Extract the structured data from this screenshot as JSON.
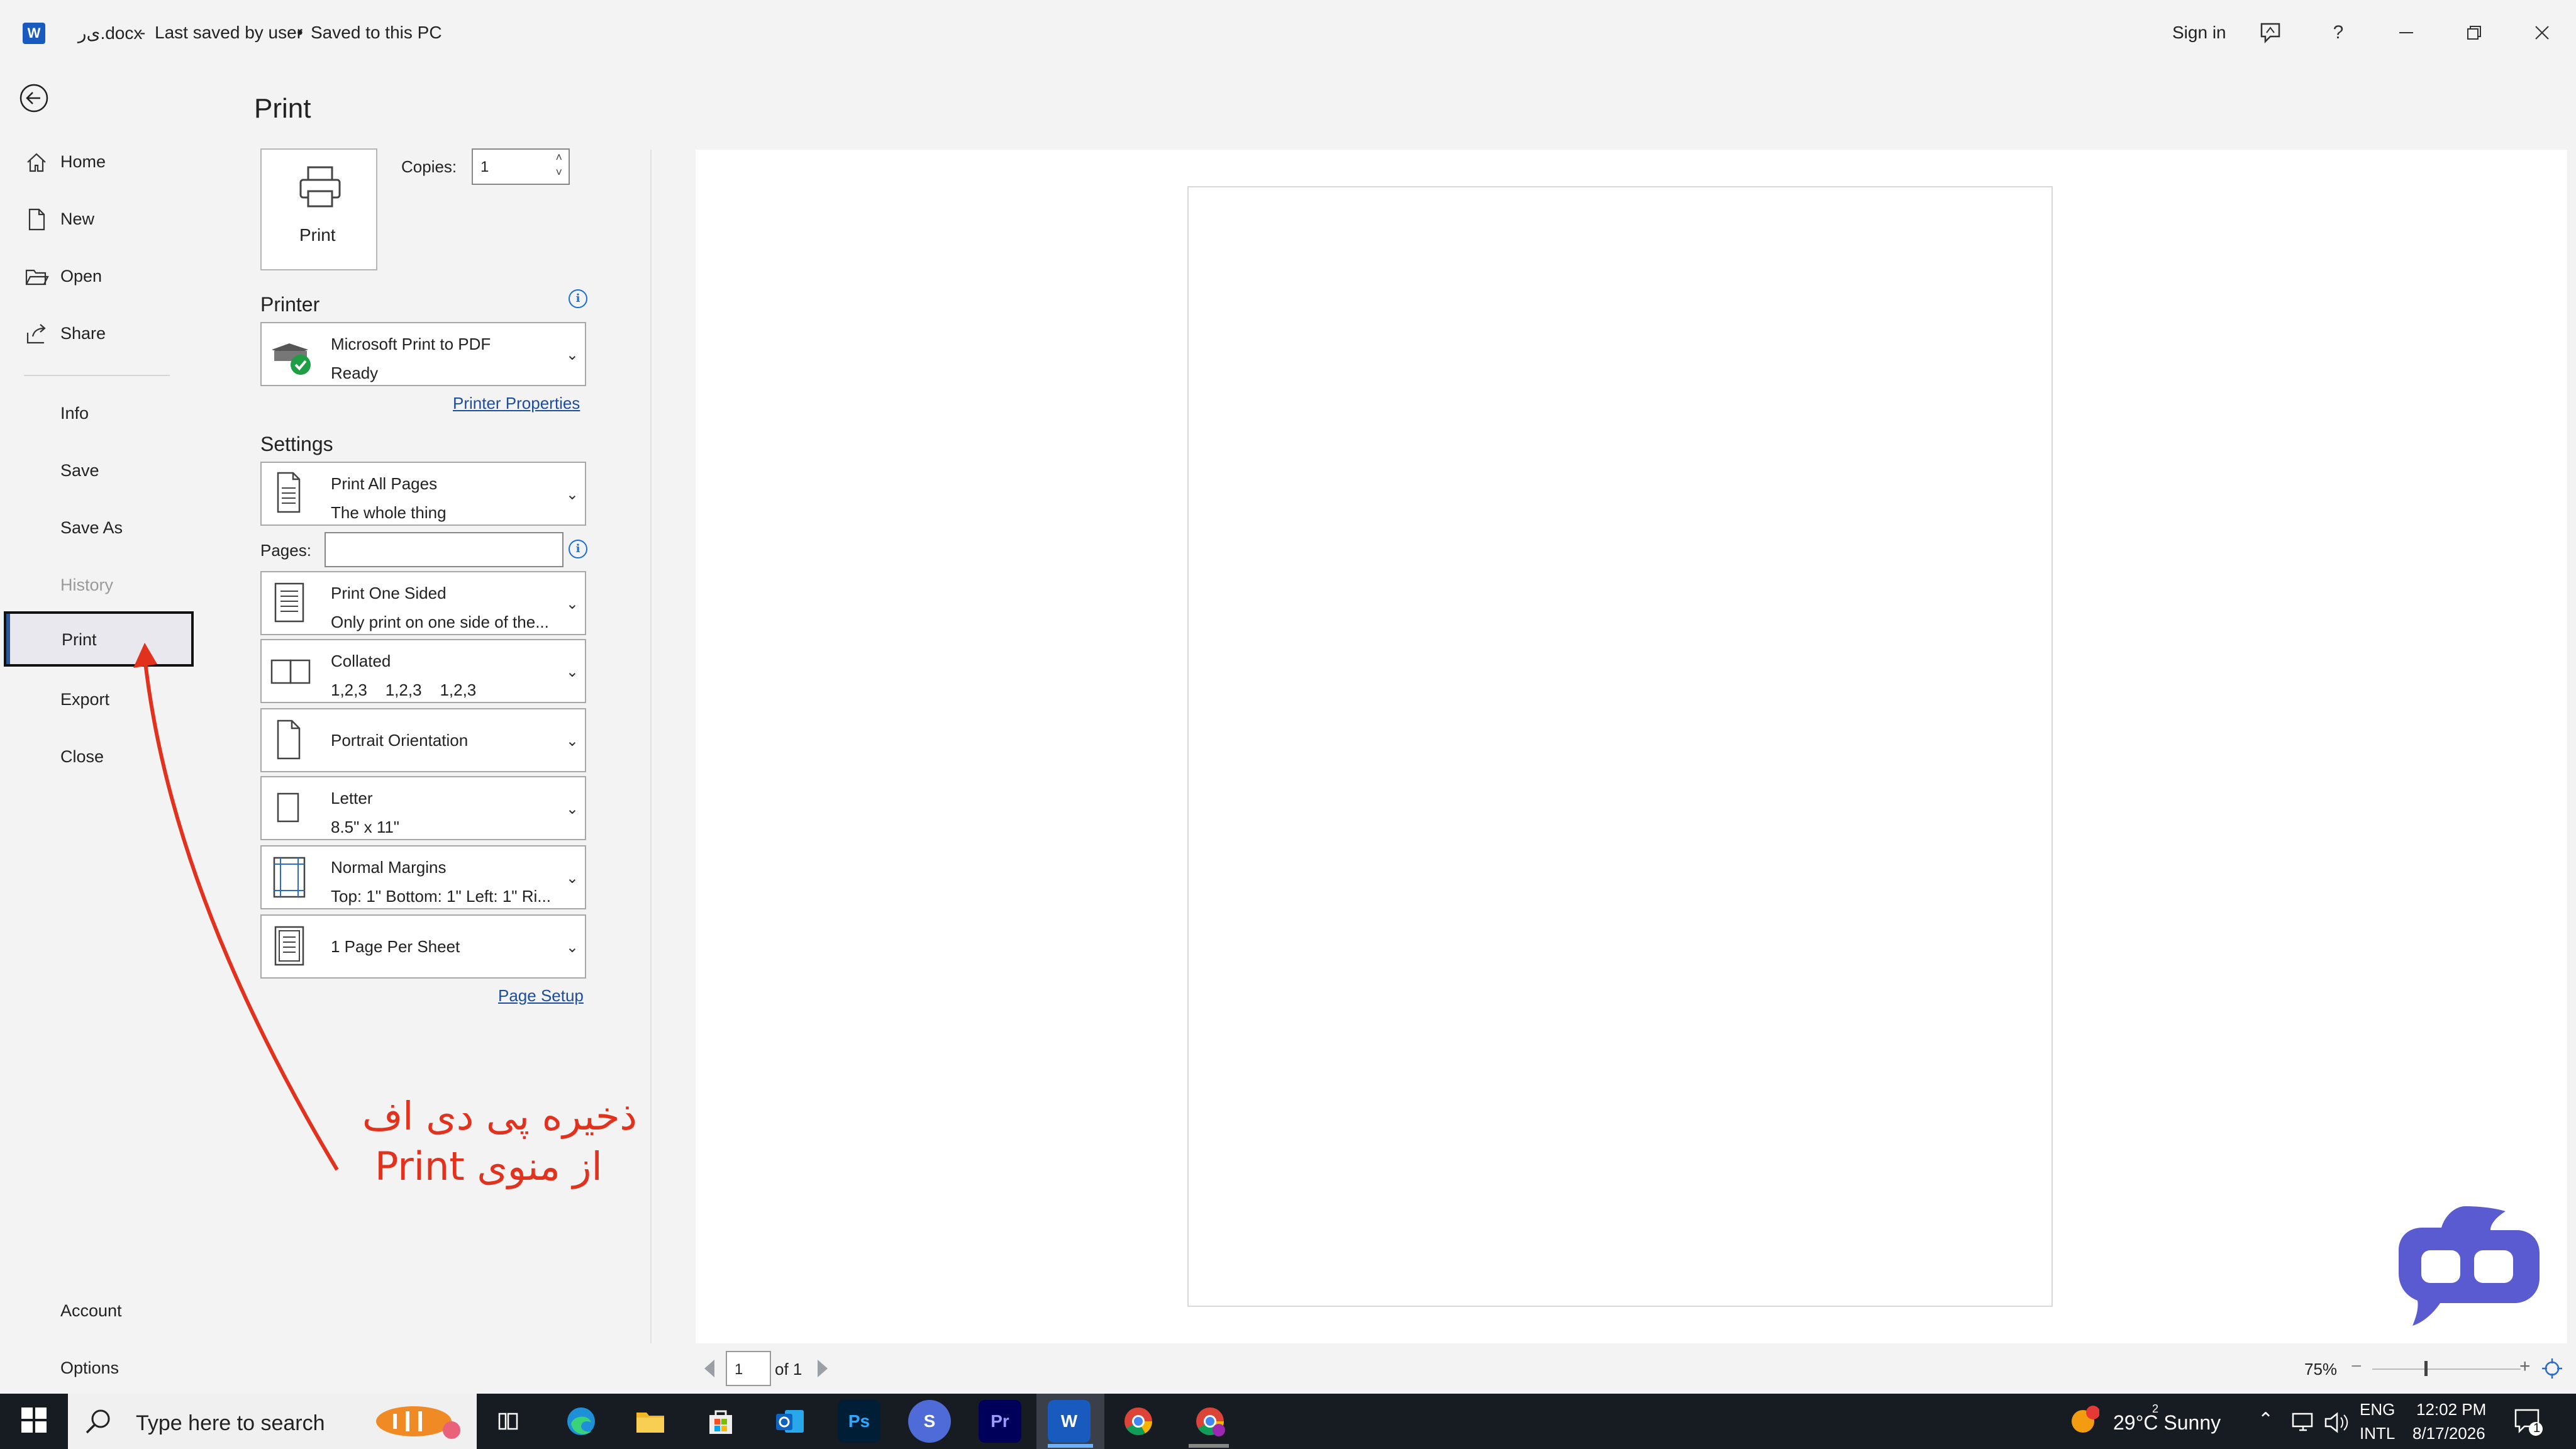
{
  "titlebar": {
    "app_icon": "W",
    "doc_title": "ی‌ر.docx",
    "separator": "-",
    "last_saved": "Last saved by user",
    "dot": "•",
    "saved_location": "Saved to this PC",
    "sign_in": "Sign in",
    "help": "?"
  },
  "sidebar": {
    "items": [
      {
        "label": "Home"
      },
      {
        "label": "New"
      },
      {
        "label": "Open"
      },
      {
        "label": "Share"
      },
      {
        "label": "Info"
      },
      {
        "label": "Save"
      },
      {
        "label": "Save As"
      },
      {
        "label": "History"
      },
      {
        "label": "Print"
      },
      {
        "label": "Export"
      },
      {
        "label": "Close"
      },
      {
        "label": "Account"
      },
      {
        "label": "Options"
      }
    ]
  },
  "print": {
    "title": "Print",
    "print_button": "Print",
    "copies_label": "Copies:",
    "copies_value": "1",
    "printer_header": "Printer",
    "printer_name": "Microsoft Print to PDF",
    "printer_status": "Ready",
    "printer_properties": "Printer Properties",
    "settings_header": "Settings",
    "pages_label": "Pages:",
    "pages_value": "",
    "page_setup": "Page Setup",
    "settings": [
      {
        "line1": "Print All Pages",
        "line2": "The whole thing"
      },
      {
        "line1": "Print One Sided",
        "line2": "Only print on one side of the..."
      },
      {
        "line1": "Collated",
        "line2": "1,2,3    1,2,3    1,2,3"
      },
      {
        "line1": "Portrait Orientation",
        "line2": ""
      },
      {
        "line1": "Letter",
        "line2": "8.5\" x 11\""
      },
      {
        "line1": "Normal Margins",
        "line2": "Top: 1\" Bottom: 1\" Left: 1\" Ri..."
      },
      {
        "line1": "1 Page Per Sheet",
        "line2": ""
      }
    ]
  },
  "preview": {
    "page_number": "1",
    "page_of": "of 1",
    "zoom": "75%",
    "zoom_minus": "−",
    "zoom_plus": "+",
    "zoom_level_percent": 75
  },
  "annotation": {
    "line1": "ذخیره پی دی اف",
    "line2": "از منوی Print",
    "color": "#e2311c"
  },
  "taskbar": {
    "search_placeholder": "Type here to search",
    "apps": [
      "task-view",
      "edge",
      "file-explorer",
      "store",
      "outlook",
      "Ps",
      "S",
      "Pr",
      "W",
      "chrome",
      "chrome-profile"
    ],
    "weather_badge": "2",
    "weather": "29°C  Sunny",
    "lang1": "ENG",
    "lang2": "INTL",
    "time": "12:02 PM",
    "date": "8/17/2026",
    "notification_count": "1"
  }
}
